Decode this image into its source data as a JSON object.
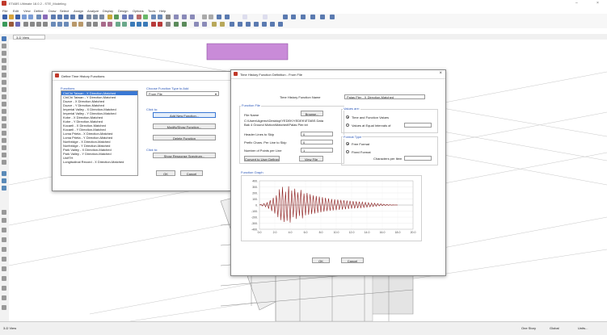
{
  "window": {
    "title": "ETABS Ultimate 18.0.2 - STE_Modeling"
  },
  "menubar": {
    "items": [
      "File",
      "Edit",
      "View",
      "Define",
      "Draw",
      "Select",
      "Assign",
      "Analyze",
      "Display",
      "Design",
      "Options",
      "Tools",
      "Help"
    ]
  },
  "view_tab": {
    "label": "3-D View"
  },
  "status": {
    "left": "3-D View",
    "right1": "One Story",
    "right2": "Global",
    "right3": "Units..."
  },
  "dlg1": {
    "title": "Define Time History Functions",
    "functions_header": "Functions",
    "functions": [
      "ChiChi Taiwan - X Direction-Matched",
      "ChiChi Taiwan - Y Direction-Matched",
      "Duzce - X Direction-Matched",
      "Duzce - Y Direction-Matched",
      "Imperial Valley - X Direction-Matched",
      "Imperial Valley - Y Direction-Matched",
      "Kobe - X Direction-Matched",
      "Kobe - Y Direction-Matched",
      "Kocaeli - X Direction-Matched",
      "Kocaeli - Y Direction-Matched",
      "Loma Prieta - X Direction-Matched",
      "Loma Prieta - Y Direction-Matched",
      "Northridge - X Direction-Matched",
      "Northridge - Y Direction-Matched",
      "Park Valley - X Direction-Matched",
      "Park Valley - Y Direction-Matched",
      "UnifTH",
      "Longitudinal Record - X Direction-Matched"
    ],
    "choose_label": "Choose Function Type to Add",
    "choose_value": "From File",
    "click_to1": "Click to:",
    "add_new_btn": "Add New Function...",
    "modify_btn": "Modify/Show Function...",
    "delete_btn": "Delete Function",
    "click_to2": "Click to:",
    "show_spectrum_btn": "Show Response Spectrum...",
    "ok_btn": "OK",
    "cancel_btn": "Cancel"
  },
  "dlg2": {
    "title": "Time History Function Definition - From File",
    "name_label": "Time History Function Name",
    "name_value": "Palas Pier - X Direction-Matched",
    "function_file_hdr": "Function File",
    "file_name_label": "File Name",
    "browse_btn": "Browse...",
    "file_path_line1": "C:\\Users\\Agemo\\Desktop\\YEDEK\\YEDEK\\ETABS Data",
    "file_path_line2": "Bak 4 Ground Motion\\Matched\\Palas Pier.txt",
    "header_lines_label": "Header Lines to Skip",
    "header_lines_value": "0",
    "prefix_label": "Prefix Chars. Per Line to Skip",
    "prefix_value": "0",
    "points_label": "Number of Points per Line",
    "points_value": "1",
    "convert_btn": "Convert to User Defined",
    "view_file_btn": "View File",
    "values_are_hdr": "Values are:",
    "radio_time_values": "Time and Function Values",
    "radio_equal_interval": "Values at Equal Intervals of",
    "format_type_hdr": "Format Type",
    "radio_free_format": "Free Format",
    "radio_fixed_format": "Fixed Format",
    "chars_per_item_label": "Characters per Item",
    "function_graph_hdr": "Function Graph",
    "ok_btn": "OK",
    "cancel_btn": "Cancel"
  },
  "chart_data": {
    "type": "line",
    "ylim": [
      -400,
      400
    ],
    "xlim": [
      0,
      20
    ],
    "yticks": [
      "400.",
      "300.",
      "200.",
      "100.",
      "0.",
      "-100.",
      "-200.",
      "-300.",
      "-400."
    ],
    "xticks": [
      "0.0",
      "2.0",
      "4.0",
      "6.0",
      "8.0",
      "10.0",
      "12.0",
      "14.0",
      "16.0",
      "18.0",
      "20.0"
    ],
    "series": [
      {
        "color": "#8b1a1a",
        "x": [
          0.0,
          0.2,
          0.4,
          0.6,
          0.8,
          1.0,
          1.2,
          1.4,
          1.6,
          1.8,
          2.0,
          2.2,
          2.4,
          2.6,
          2.8,
          3.0,
          3.2,
          3.4,
          3.6,
          3.8,
          4.0,
          4.2,
          4.4,
          4.6,
          4.8,
          5.0,
          5.2,
          5.4,
          5.6,
          5.8,
          6.0,
          6.2,
          6.4,
          6.6,
          6.8,
          7.0,
          7.2,
          7.4,
          7.6,
          7.8,
          8.0,
          8.2,
          8.4,
          8.6,
          8.8,
          9.0,
          9.2,
          9.4,
          9.6,
          9.8,
          10.0,
          10.2,
          10.4,
          10.6,
          10.8,
          11.0,
          11.2,
          11.4,
          11.6,
          11.8,
          12.0,
          12.2,
          12.4,
          12.6,
          12.8,
          13.0,
          13.2,
          13.4,
          13.6,
          13.8,
          14.0,
          14.2,
          14.4,
          14.6,
          14.8,
          15.0,
          15.2,
          15.4,
          15.6,
          15.8,
          16.0,
          16.2,
          16.4,
          16.6,
          16.8,
          17.0,
          17.2,
          17.4,
          17.6,
          17.8,
          18.0
        ],
        "y": [
          0,
          10,
          -15,
          25,
          -30,
          40,
          -60,
          80,
          -100,
          120,
          -140,
          160,
          -200,
          260,
          -250,
          300,
          -280,
          220,
          -260,
          310,
          -290,
          240,
          -200,
          270,
          -230,
          210,
          -180,
          250,
          -220,
          190,
          -170,
          200,
          -160,
          180,
          -150,
          160,
          -140,
          150,
          -130,
          140,
          -120,
          130,
          -110,
          120,
          -100,
          110,
          -95,
          100,
          -90,
          95,
          -85,
          90,
          -80,
          85,
          -75,
          80,
          -70,
          75,
          -65,
          70,
          -60,
          65,
          -55,
          60,
          -50,
          55,
          -45,
          50,
          -40,
          45,
          -35,
          40,
          -30,
          35,
          -25,
          30,
          -20,
          25,
          -15,
          20,
          -10,
          15,
          -8,
          10,
          -5,
          6,
          -3,
          2,
          0,
          1,
          0
        ]
      }
    ]
  }
}
